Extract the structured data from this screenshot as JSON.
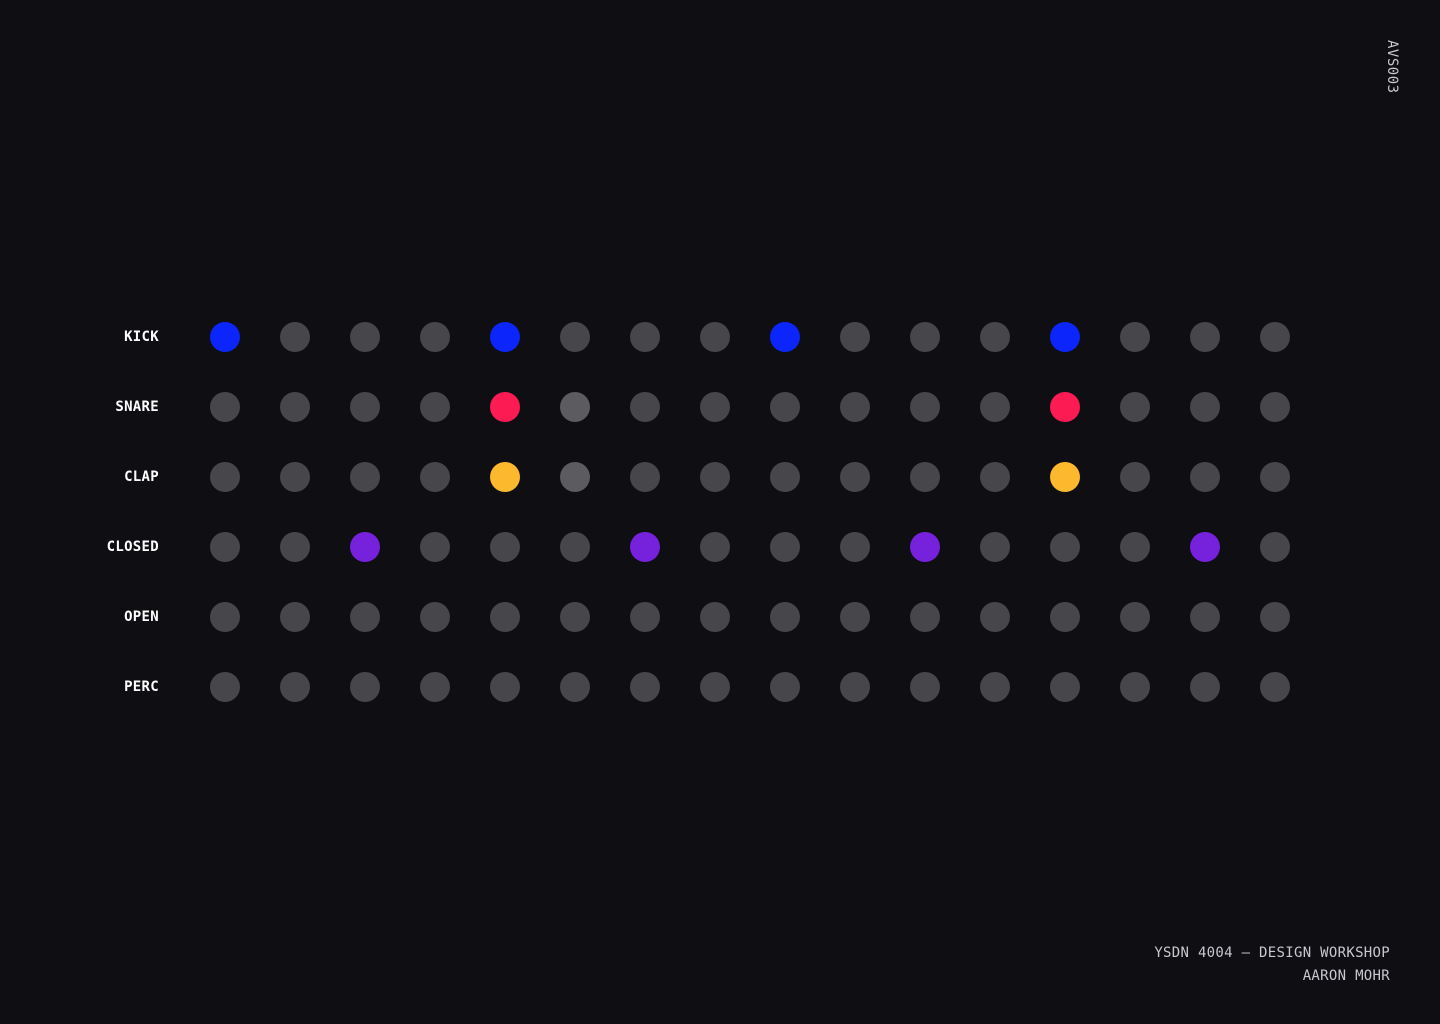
{
  "code": "AVS003",
  "footer": {
    "course": "YSDN 4004 — DESIGN WORKSHOP",
    "author": "AARON MOHR"
  },
  "colors": {
    "background": "#0f0e13",
    "inactive_step": "#47464b",
    "playhead_step": "#5c5b60",
    "kick": "#0b25fb",
    "snare": "#fc1b53",
    "clap": "#fcb92d",
    "closed": "#7621dc"
  },
  "sequencer": {
    "steps_count": 16,
    "playhead_step": 5,
    "tracks": [
      {
        "label": "KICK",
        "color": "#0b25fb",
        "active": [
          0,
          4,
          8,
          12
        ]
      },
      {
        "label": "SNARE",
        "color": "#fc1b53",
        "active": [
          4,
          12
        ]
      },
      {
        "label": "CLAP",
        "color": "#fcb92d",
        "active": [
          4,
          12
        ]
      },
      {
        "label": "CLOSED",
        "color": "#7621dc",
        "active": [
          2,
          6,
          10,
          14
        ]
      },
      {
        "label": "OPEN",
        "color": "#7621dc",
        "active": []
      },
      {
        "label": "PERC",
        "color": "#7621dc",
        "active": []
      }
    ]
  }
}
